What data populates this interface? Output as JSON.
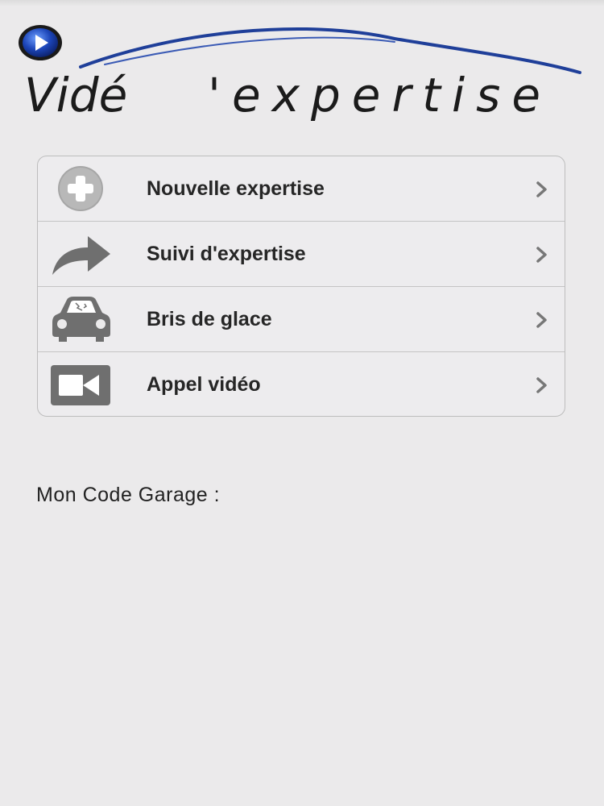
{
  "logo": {
    "text_left": "Vidé",
    "text_right": "'expertise"
  },
  "menu": {
    "items": [
      {
        "label": "Nouvelle expertise",
        "icon": "plus-circle-icon"
      },
      {
        "label": "Suivi d'expertise",
        "icon": "share-arrow-icon"
      },
      {
        "label": "Bris de glace",
        "icon": "car-broken-windshield-icon"
      },
      {
        "label": "Appel vidéo",
        "icon": "video-camera-icon"
      }
    ]
  },
  "garage": {
    "label": "Mon Code Garage :"
  },
  "colors": {
    "background": "#ebeaeb",
    "icon_gray": "#6f6f6f",
    "logo_blue": "#1f3f99"
  }
}
